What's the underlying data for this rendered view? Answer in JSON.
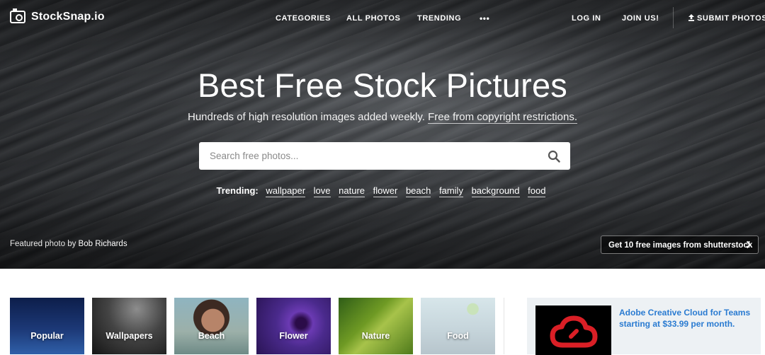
{
  "nav": {
    "brand": "StockSnap.io",
    "links": {
      "categories": "CATEGORIES",
      "all_photos": "ALL PHOTOS",
      "trending": "TRENDING",
      "more": "•••",
      "login": "LOG IN",
      "join": "JOIN US!",
      "submit": "SUBMIT PHOTOS"
    }
  },
  "hero": {
    "title": "Best Free Stock Pictures",
    "subtitle_text": "Hundreds of high resolution images added weekly.",
    "subtitle_link": "Free from copyright restrictions.",
    "search_placeholder": "Search free photos...",
    "trending_label": "Trending:",
    "trending_tags": [
      "wallpaper",
      "love",
      "nature",
      "flower",
      "beach",
      "family",
      "background",
      "food"
    ],
    "featured_prefix": "Featured photo by",
    "featured_author": "Bob Richards",
    "shutterstock_button": "Get 10 free images from shutterstock"
  },
  "categories": [
    "Popular",
    "Wallpapers",
    "Beach",
    "Flower",
    "Nature",
    "Food"
  ],
  "ad": {
    "text": "Adobe Creative Cloud for Teams starting at $33.99 per month.",
    "brand_color": "#da1f26"
  },
  "colors": {
    "ad_link": "#2a7bd1",
    "ad_background": "#edf1f4"
  }
}
